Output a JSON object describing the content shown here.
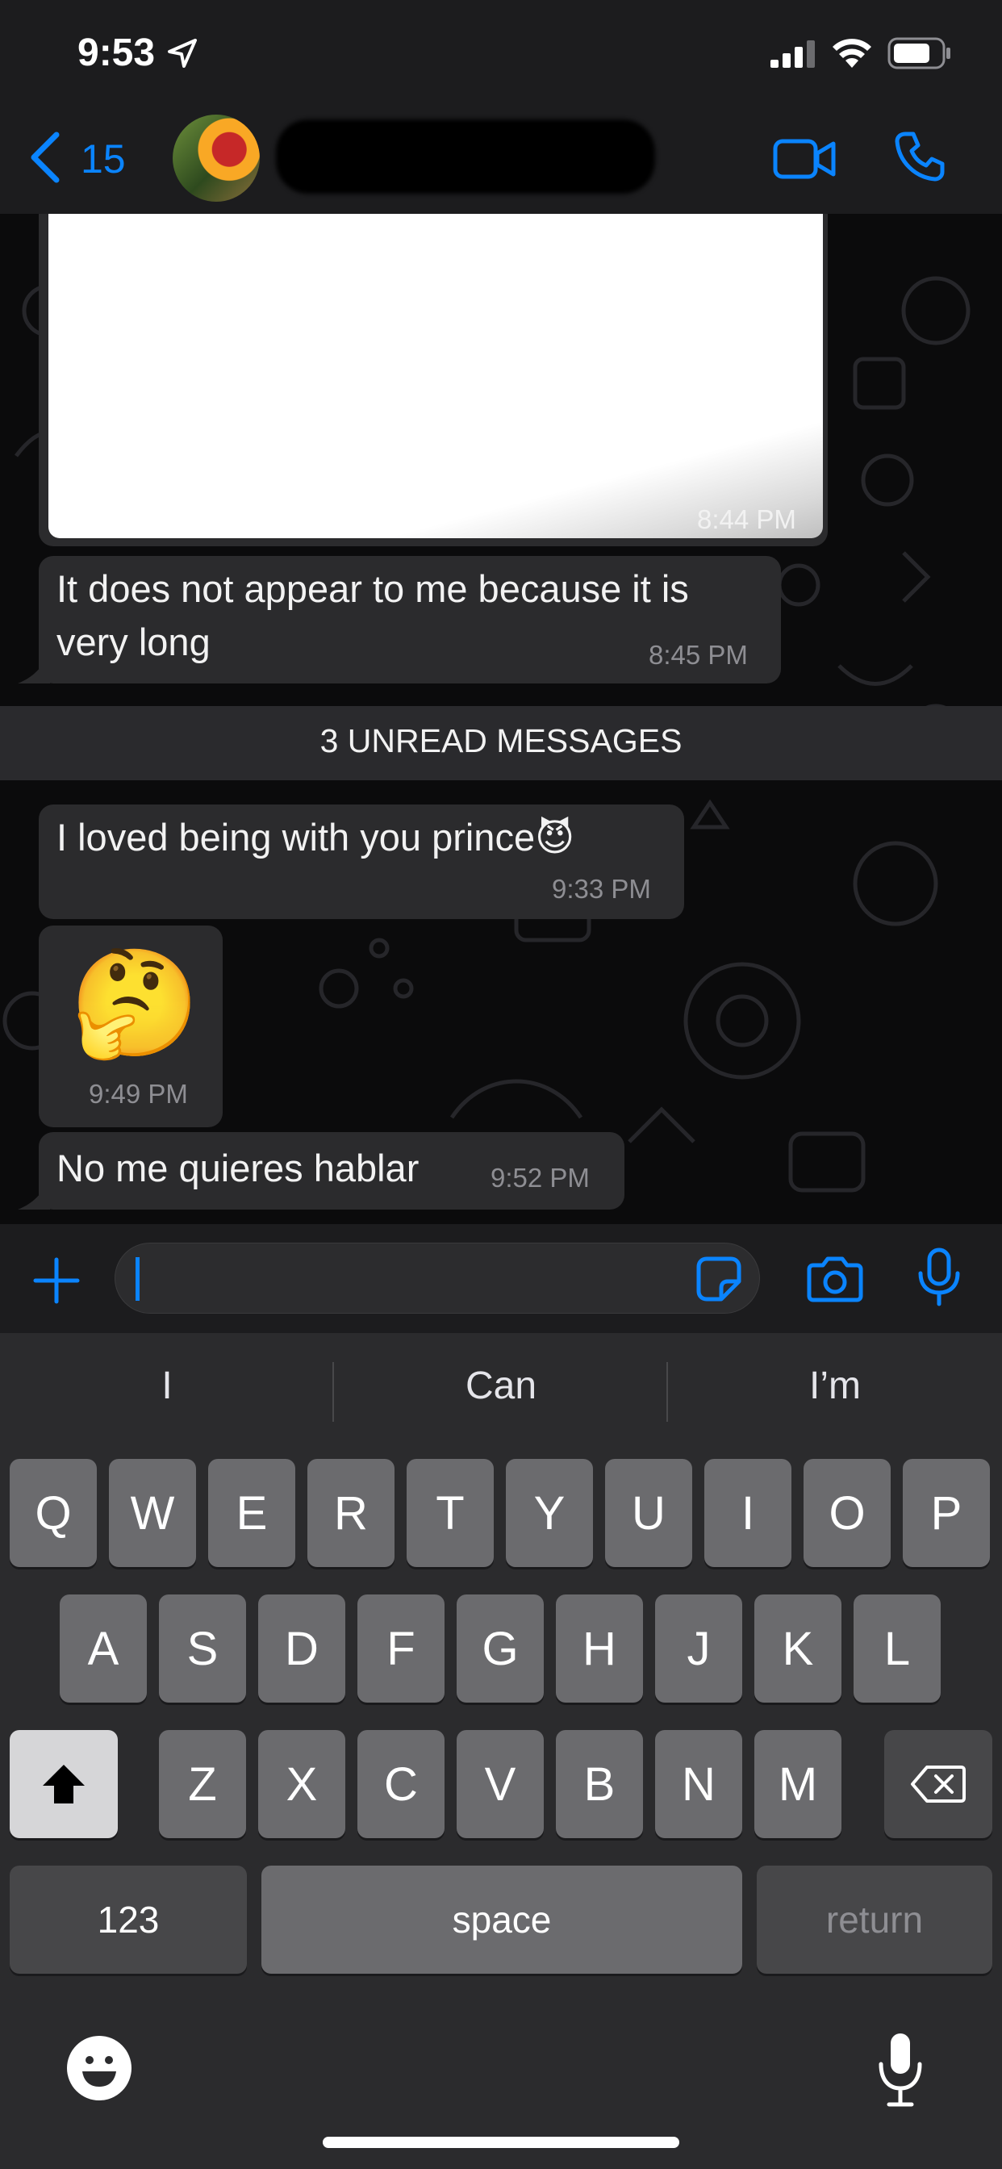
{
  "status_bar": {
    "time": "9:53"
  },
  "header": {
    "back_count": "15"
  },
  "messages": [
    {
      "text": "",
      "time": "8:44 PM",
      "kind": "image"
    },
    {
      "text": "It does not appear to me because it is very long",
      "line1": "It does not appear to me because it is",
      "line2": "very long",
      "time": "8:45 PM"
    },
    {
      "text": "I loved being with you prince😈",
      "time": "9:33 PM"
    },
    {
      "text": "🤔",
      "time": "9:49 PM"
    },
    {
      "text": "No me quieres hablar",
      "time": "9:52 PM"
    }
  ],
  "unread_banner": "3 UNREAD MESSAGES",
  "composer": {
    "input_value": ""
  },
  "keyboard": {
    "suggestions": [
      "I",
      "Can",
      "I’m"
    ],
    "row1": [
      "Q",
      "W",
      "E",
      "R",
      "T",
      "Y",
      "U",
      "I",
      "O",
      "P"
    ],
    "row2": [
      "A",
      "S",
      "D",
      "F",
      "G",
      "H",
      "J",
      "K",
      "L"
    ],
    "row3": [
      "Z",
      "X",
      "C",
      "V",
      "B",
      "N",
      "M"
    ],
    "numbers_label": "123",
    "space_label": "space",
    "return_label": "return"
  },
  "colors": {
    "accent": "#0a84ff",
    "bubble": "#2b2b2d",
    "background": "#0b0b0c"
  }
}
